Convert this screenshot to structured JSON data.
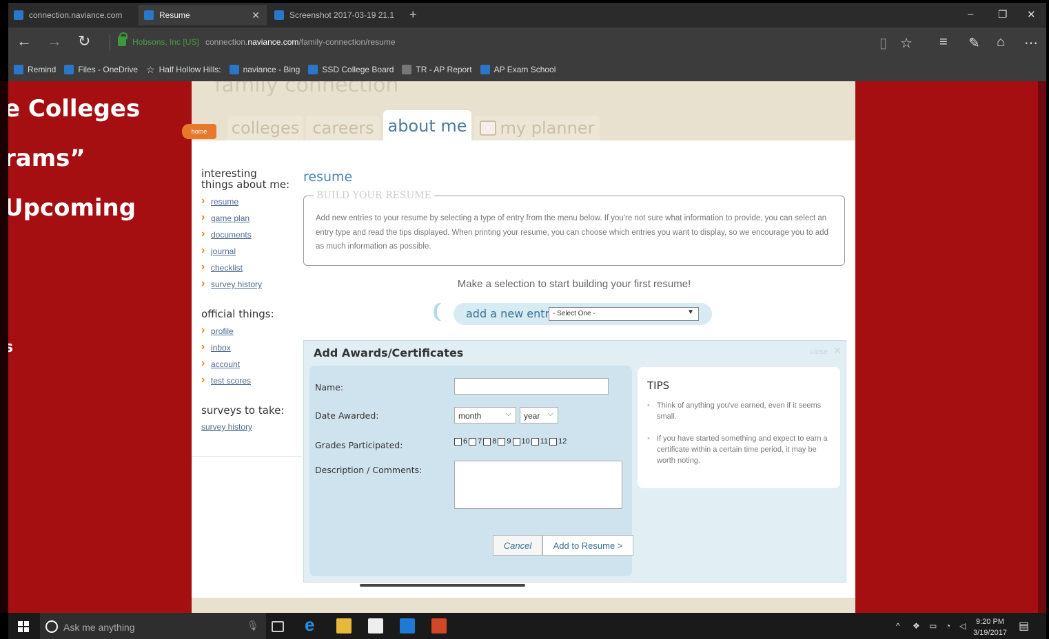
{
  "browser": {
    "tabs": [
      {
        "label": "connection.naviance.com"
      },
      {
        "label": "Resume"
      },
      {
        "label": "Screenshot 2017-03-19 21.1"
      }
    ],
    "site_identity": "Hobsons, Inc [US]",
    "url_prefix": "connection.",
    "url_domain": "naviance.com",
    "url_path": "/family-connection/resume",
    "favorites": [
      "Remind",
      "Files - OneDrive",
      "Half Hollow Hills:",
      "naviance - Bing",
      "SSD College Board",
      "TR - AP Report",
      "AP Exam School"
    ]
  },
  "slide": {
    "line1": "e Colleges",
    "line2": "rams”",
    "line3": "Upcoming",
    "line4": "s"
  },
  "site": {
    "watermark": "family connection",
    "home_label": "home",
    "tabs": {
      "colleges": "colleges",
      "careers": "careers",
      "about_me": "about me",
      "my_planner": "my planner"
    },
    "nav_interesting_head": "interesting things about me:",
    "nav_interesting": [
      "resume",
      "game plan",
      "documents",
      "journal",
      "checklist",
      "survey history"
    ],
    "nav_official_head": "official things:",
    "nav_official": [
      "profile",
      "inbox",
      "account",
      "test scores"
    ],
    "nav_surveys_head": "surveys to take:",
    "nav_surveys": [
      "survey history"
    ]
  },
  "resume": {
    "title": "resume",
    "build_legend": "BUILD YOUR RESUME",
    "build_text": "Add new entries to your resume by selecting a type of entry from the menu below. If you're not sure what information to provide, you can select an entry type and read the tips displayed. When printing your resume, you can choose which entries you want to display, so we encourage you to add as much information as possible.",
    "make_selection": "Make a selection to start building your first resume!",
    "add_entry_label": "add a new entry:",
    "select_value": "- Select One -"
  },
  "award_form": {
    "heading": "Add Awards/Certificates",
    "close_label": "close",
    "name_label": "Name:",
    "date_label": "Date Awarded:",
    "month_value": "month",
    "year_value": "year",
    "grades_label": "Grades Participated:",
    "grades": [
      "6",
      "7",
      "8",
      "9",
      "10",
      "11",
      "12"
    ],
    "desc_label": "Description / Comments:",
    "cancel_label": "Cancel",
    "add_label": "Add to Resume >",
    "tips_head": "TIPS",
    "tips": [
      "Think of anything you've earned, even if it seems small.",
      "If you have started something and expect to earn a certificate within a certain time period, it may be worth noting."
    ]
  },
  "taskbar": {
    "search_placeholder": "Ask me anything",
    "time": "9:20 PM",
    "date": "3/19/2017"
  },
  "colors": {
    "slide_red": "#a50f12",
    "link_blue": "#4e6a8e",
    "accent_orange": "#e8782b",
    "panel_blue": "#e1eff5"
  }
}
